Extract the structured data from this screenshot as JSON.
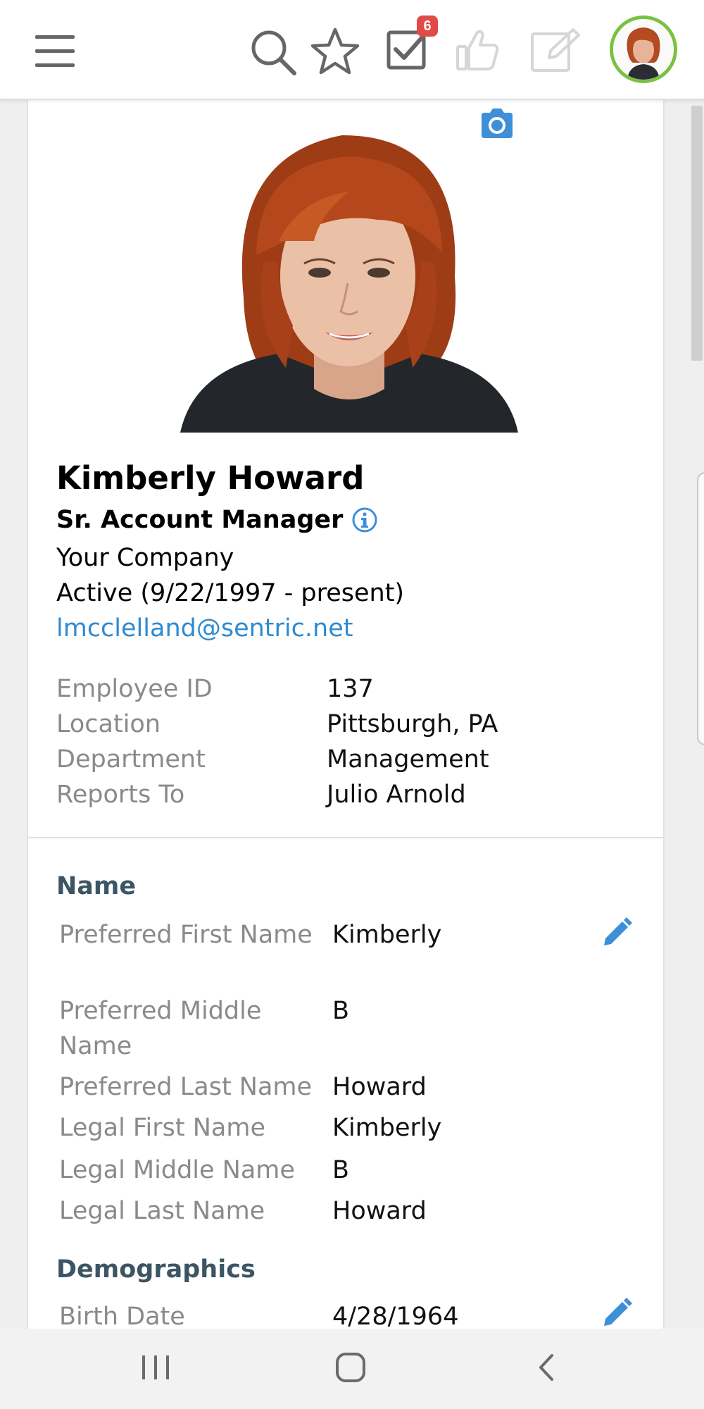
{
  "topbar": {
    "menu_icon": "hamburger-menu-icon",
    "search_icon": "search-icon",
    "favorites_icon": "star-icon",
    "tasks_icon": "checkbox-icon",
    "tasks_badge": "6",
    "like_icon": "thumbs-up-icon",
    "edit_icon": "edit-icon",
    "avatar_ring_color": "#7ac142",
    "badge_color": "#e24a48"
  },
  "profile": {
    "name": "Kimberly Howard",
    "title": "Sr. Account Manager",
    "company": "Your Company",
    "status": "Active (9/22/1997 - present)",
    "email": "lmcclelland@sentric.net",
    "link_color": "#2f8ad0"
  },
  "details": [
    {
      "label": "Employee ID",
      "value": "137"
    },
    {
      "label": "Location",
      "value": "Pittsburgh, PA"
    },
    {
      "label": "Department",
      "value": "Management"
    },
    {
      "label": "Reports To",
      "value": "Julio Arnold"
    }
  ],
  "name_section": {
    "title": "Name",
    "fields": [
      {
        "label": "Preferred First Name",
        "value": "Kimberly"
      },
      {
        "label": "Preferred Middle Name",
        "value": "B"
      },
      {
        "label": "Preferred Last Name",
        "value": "Howard"
      },
      {
        "label": "Legal First Name",
        "value": "Kimberly"
      },
      {
        "label": "Legal Middle Name",
        "value": "B"
      },
      {
        "label": "Legal Last Name",
        "value": "Howard"
      }
    ]
  },
  "demographics_section": {
    "title": "Demographics",
    "fields": [
      {
        "label": "Birth Date",
        "value": "4/28/1964"
      }
    ]
  },
  "section_title_color": "#3b5563",
  "bottom_nav": {
    "recent_icon": "recent-apps-icon",
    "home_icon": "home-icon",
    "back_icon": "back-icon"
  }
}
